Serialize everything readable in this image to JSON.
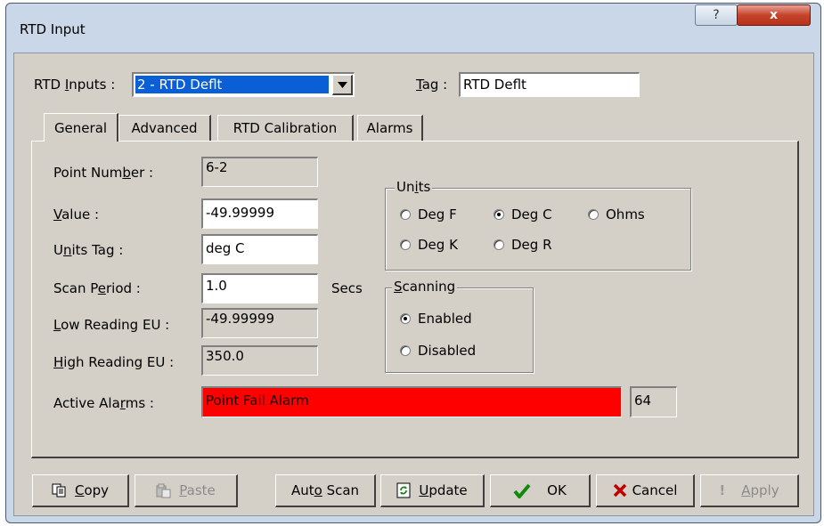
{
  "window": {
    "title": "RTD Input",
    "help_label": "?",
    "close_label": "x"
  },
  "header": {
    "rtd_inputs_label_pre": "RTD ",
    "rtd_inputs_label_u": "I",
    "rtd_inputs_label_post": "nputs :",
    "rtd_inputs_value": "2 - RTD Deflt",
    "tag_label_u": "T",
    "tag_label_post": "ag :",
    "tag_value": "RTD Deflt"
  },
  "tabs": [
    {
      "label": "General",
      "active": true
    },
    {
      "label": "Advanced",
      "active": false
    },
    {
      "label": "RTD Calibration",
      "active": false
    },
    {
      "label": "Alarms",
      "active": false
    }
  ],
  "general": {
    "point_number": {
      "label_pre": "Point Num",
      "label_u": "b",
      "label_post": "er :",
      "value": "6-2"
    },
    "value": {
      "label_u": "V",
      "label_post": "alue :",
      "value": "-49.99999"
    },
    "units_tag": {
      "label_pre": "U",
      "label_u": "n",
      "label_post": "its Tag :",
      "value": "deg C"
    },
    "scan_period": {
      "label_pre": "Scan P",
      "label_u": "e",
      "label_post": "riod :",
      "value": "1.0",
      "unit": "Secs"
    },
    "low_reading": {
      "label_u": "L",
      "label_post": "ow Reading EU :",
      "value": "-49.99999"
    },
    "high_reading": {
      "label_u": "H",
      "label_post": "igh Reading EU :",
      "value": "350.0"
    },
    "active_alarms": {
      "label_pre": "Active Ala",
      "label_u": "r",
      "label_post": "ms :",
      "value": "Point Fail Alarm",
      "count": "64",
      "alarm_color": "#ff0000"
    }
  },
  "units_group": {
    "title_pre": "Un",
    "title_u": "i",
    "title_post": "ts",
    "options": [
      {
        "label": "Deg F",
        "selected": false
      },
      {
        "label": "Deg C",
        "selected": true
      },
      {
        "label": "Ohms",
        "selected": false
      },
      {
        "label": "Deg K",
        "selected": false
      },
      {
        "label": "Deg R",
        "selected": false
      }
    ]
  },
  "scanning_group": {
    "title_u": "S",
    "title_post": "canning",
    "options": [
      {
        "label": "Enabled",
        "selected": true
      },
      {
        "label": "Disabled",
        "selected": false
      }
    ]
  },
  "footer": {
    "copy_u": "C",
    "copy_post": "opy",
    "paste_u": "P",
    "paste_post": "aste",
    "autoscan_pre": "Aut",
    "autoscan_u": "o",
    "autoscan_post": " Scan",
    "update_u": "U",
    "update_post": "pdate",
    "ok_label": "OK",
    "cancel_label": "Cancel",
    "apply_u": "A",
    "apply_post": "pply"
  },
  "colors": {
    "alarm_red": "#ff0000",
    "ok_green": "#0f8a0f",
    "cancel_red": "#c00000",
    "dialog_face": "#d4d0c8"
  }
}
